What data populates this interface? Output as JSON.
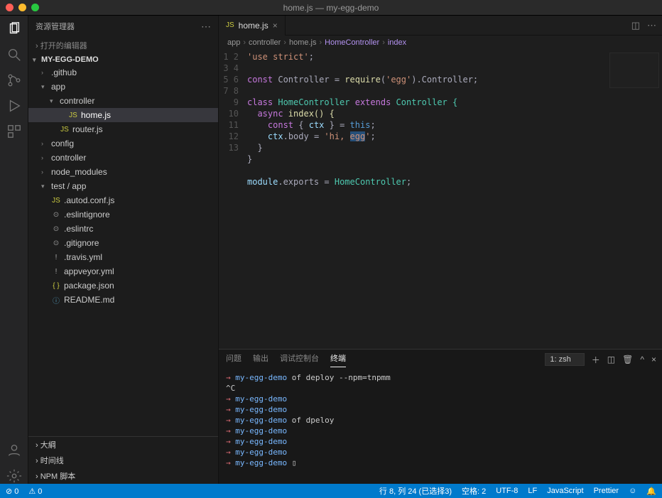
{
  "title": "home.js — my-egg-demo",
  "sidebar": {
    "title": "资源管理器",
    "openEditors": "打开的编辑器",
    "project": "MY-EGG-DEMO",
    "tree": [
      {
        "kind": "folder",
        "exp": 0,
        "d": 1,
        "label": ".github"
      },
      {
        "kind": "folder",
        "exp": 1,
        "d": 1,
        "label": "app"
      },
      {
        "kind": "folder",
        "exp": 1,
        "d": 2,
        "label": "controller"
      },
      {
        "kind": "file",
        "sel": 1,
        "icon": "js",
        "d": 3,
        "label": "home.js"
      },
      {
        "kind": "file",
        "icon": "js",
        "d": 2,
        "label": "router.js"
      },
      {
        "kind": "folder",
        "exp": 0,
        "d": 1,
        "label": "config"
      },
      {
        "kind": "folder",
        "exp": 0,
        "d": 1,
        "label": "controller"
      },
      {
        "kind": "folder",
        "exp": 0,
        "d": 1,
        "label": "node_modules"
      },
      {
        "kind": "folder",
        "exp": 1,
        "d": 1,
        "label": "test / app"
      },
      {
        "kind": "file",
        "icon": "js",
        "d": 1,
        "label": ".autod.conf.js"
      },
      {
        "kind": "file",
        "icon": "gear",
        "d": 1,
        "label": ".eslintignore"
      },
      {
        "kind": "file",
        "icon": "gear",
        "d": 1,
        "label": ".eslintrc"
      },
      {
        "kind": "file",
        "icon": "gear",
        "d": 1,
        "label": ".gitignore"
      },
      {
        "kind": "file",
        "icon": "yml",
        "d": 1,
        "label": ".travis.yml"
      },
      {
        "kind": "file",
        "icon": "yml",
        "d": 1,
        "label": "appveyor.yml"
      },
      {
        "kind": "file",
        "icon": "json",
        "d": 1,
        "label": "package.json"
      },
      {
        "kind": "file",
        "icon": "md",
        "d": 1,
        "label": "README.md"
      }
    ],
    "panels": [
      "大綱",
      "时间线",
      "NPM 脚本"
    ]
  },
  "tab": {
    "file": "home.js"
  },
  "breadcrumb": [
    "app",
    "controller",
    "home.js",
    "HomeController",
    "index"
  ],
  "code": {
    "lines": [
      1,
      2,
      3,
      4,
      5,
      6,
      7,
      8,
      9,
      10,
      11,
      12,
      13
    ],
    "l1": "'use strict'",
    "l1b": ";",
    "l3a": "const",
    "l3b": " Controller = ",
    "l3c": "require",
    "l3d": "(",
    "l3e": "'egg'",
    "l3f": ").Controller;",
    "l5a": "class",
    "l5b": " HomeController ",
    "l5c": "extends",
    "l5d": " Controller {",
    "l6a": "async",
    "l6b": " index() {",
    "l7a": "const",
    "l7b": " { ",
    "l7c": "ctx",
    "l7d": " } = ",
    "l7e": "this",
    "l7f": ";",
    "l8a": "ctx",
    "l8b": ".body = ",
    "l8c": "'hi, ",
    "l8d": "egg",
    "l8e": "'",
    "l8f": ";",
    "l9": "}",
    "l10": "}",
    "l12a": "module",
    "l12b": ".exports = ",
    "l12c": "HomeController",
    "l12d": ";"
  },
  "panel": {
    "tabs": [
      "问题",
      "输出",
      "调试控制台",
      "终端"
    ],
    "activeTab": 3,
    "shell": "1: zsh",
    "lines": [
      {
        "t": "cmd",
        "arrow": "→",
        "proj": "my-egg-demo",
        "rest": " of deploy --npm=tnpmm"
      },
      {
        "t": "plain",
        "text": "^C"
      },
      {
        "t": "cmd",
        "arrow": "→",
        "proj": "my-egg-demo",
        "rest": ""
      },
      {
        "t": "cmd",
        "arrow": "→",
        "proj": "my-egg-demo",
        "rest": ""
      },
      {
        "t": "cmd",
        "arrow": "→",
        "proj": "my-egg-demo",
        "rest": " of dpeloy"
      },
      {
        "t": "cmd",
        "arrow": "→",
        "proj": "my-egg-demo",
        "rest": ""
      },
      {
        "t": "cmd",
        "arrow": "→",
        "proj": "my-egg-demo",
        "rest": ""
      },
      {
        "t": "cmd",
        "arrow": "→",
        "proj": "my-egg-demo",
        "rest": ""
      },
      {
        "t": "prompt",
        "arrow": "→",
        "proj": "my-egg-demo",
        "cursor": "▯"
      }
    ]
  },
  "status": {
    "errors": "⊘ 0",
    "warnings": "⚠ 0",
    "cursor": "行 8, 列 24 (已选择3)",
    "spaces": "空格: 2",
    "encoding": "UTF-8",
    "eol": "LF",
    "lang": "JavaScript",
    "formatter": "Prettier",
    "feedback": "☺",
    "bell": "🔔"
  }
}
